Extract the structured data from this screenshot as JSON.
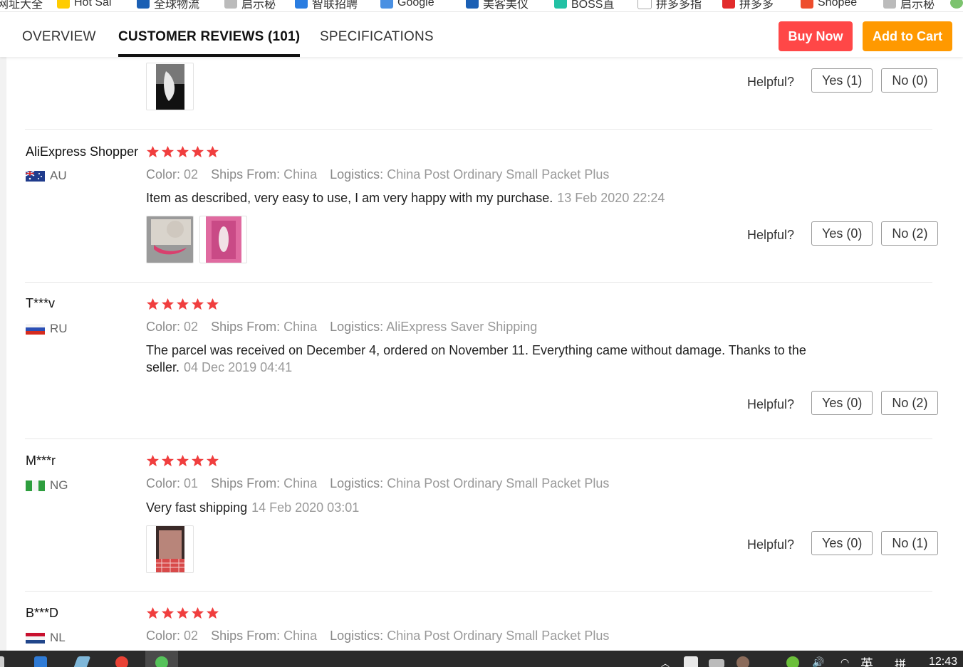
{
  "browser": {
    "bookmarks": [
      {
        "label": "网址大全",
        "color": "#e6e6e6"
      },
      {
        "label": "Hot Sal",
        "color": "#ffcc00"
      },
      {
        "label": "全球物流",
        "color": "#1a5fb4"
      },
      {
        "label": "启示秘",
        "color": "#bbbbbb"
      },
      {
        "label": "智联招聘",
        "color": "#2a7de1"
      },
      {
        "label": "Google",
        "color": "#4a90e2"
      },
      {
        "label": "美客美仪",
        "color": "#1a5fb4"
      },
      {
        "label": "BOSS直",
        "color": "#22c1a4"
      },
      {
        "label": "拼多多指",
        "color": "#dddddd"
      },
      {
        "label": "拼多多",
        "color": "#e22b2b"
      },
      {
        "label": "Shopee",
        "color": "#ee4d2d"
      },
      {
        "label": "启示秘",
        "color": "#bbbbbb"
      }
    ]
  },
  "tabs": [
    {
      "label": "OVERVIEW",
      "active": false
    },
    {
      "label": "CUSTOMER REVIEWS (101)",
      "active": true
    },
    {
      "label": "SPECIFICATIONS",
      "active": false
    }
  ],
  "actions": {
    "buy_now": "Buy Now",
    "add_to_cart": "Add to Cart"
  },
  "colors": {
    "buy": "#ff4747",
    "cart": "#ff9900",
    "star": "#f03e3e"
  },
  "labels": {
    "helpful": "Helpful?",
    "color": "Color:",
    "ships_from": "Ships From:",
    "logistics": "Logistics:"
  },
  "partial_review": {
    "helpful_yes": "Yes (1)",
    "helpful_no": "No (0)"
  },
  "reviews": [
    {
      "user": "AliExpress Shopper",
      "country": "AU",
      "flag": "australia-flag",
      "stars": 5,
      "color": "02",
      "ships_from": "China",
      "logistics": "China Post Ordinary Small Packet Plus",
      "text": "Item as described, very easy to use, I am very happy with my purchase.",
      "date": "13 Feb 2020 22:24",
      "helpful_yes": "Yes (0)",
      "helpful_no": "No (2)"
    },
    {
      "user": "T***v",
      "country": "RU",
      "flag": "russia-flag",
      "stars": 5,
      "color": "02",
      "ships_from": "China",
      "logistics": "AliExpress Saver Shipping",
      "text": "The parcel was received on December 4, ordered on November 11. Everything came without damage. Thanks to the seller.",
      "date": "04 Dec 2019 04:41",
      "helpful_yes": "Yes (0)",
      "helpful_no": "No (2)"
    },
    {
      "user": "M***r",
      "country": "NG",
      "flag": "nigeria-flag",
      "stars": 5,
      "color": "01",
      "ships_from": "China",
      "logistics": "China Post Ordinary Small Packet Plus",
      "text": "Very fast shipping",
      "date": "14 Feb 2020 03:01",
      "helpful_yes": "Yes (0)",
      "helpful_no": "No (1)"
    },
    {
      "user": "B***D",
      "country": "NL",
      "flag": "netherlands-flag",
      "stars": 5,
      "color": "02",
      "ships_from": "China",
      "logistics": "China Post Ordinary Small Packet Plus"
    }
  ],
  "taskbar": {
    "ime": "英",
    "grid": "拼",
    "clock": "12:43"
  }
}
